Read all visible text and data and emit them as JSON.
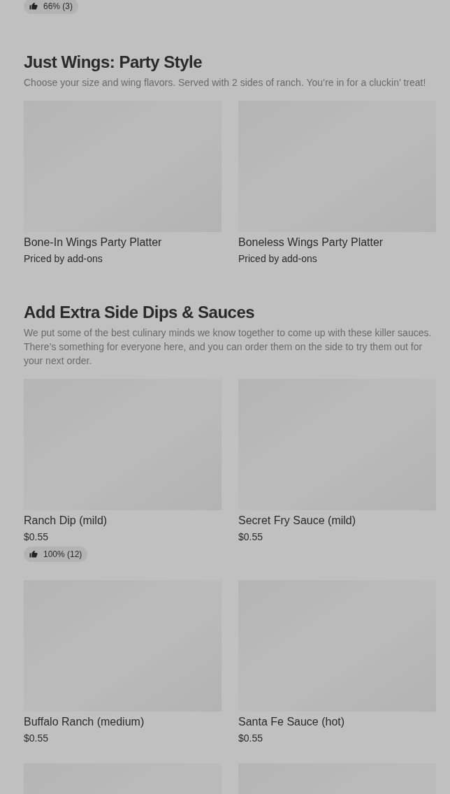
{
  "top_rating": {
    "text": "66% (3)"
  },
  "sections": [
    {
      "title": "Just Wings: Party Style",
      "description": "Choose your size and wing flavors. Served with 2 sides of ranch. You’re in for a cluckin’ treat!",
      "items": [
        {
          "kind": "product",
          "name": "Bone-In Wings Party Platter",
          "price": "Priced by add-ons"
        },
        {
          "kind": "product",
          "name": "Boneless Wings Party Platter",
          "price": "Priced by add-ons"
        }
      ]
    },
    {
      "title": "Add Extra Side Dips & Sauces",
      "description": "We put some of the best culinary minds we know together to come up with these killer sauces. There’s something for everyone here, and you can order them on the side to try them out for your next order.",
      "items": [
        {
          "kind": "product",
          "name": "Ranch Dip (mild)",
          "price": "$0.55",
          "rating": "100% (12)"
        },
        {
          "kind": "product",
          "name": "Secret Fry Sauce (mild)",
          "price": "$0.55"
        },
        {
          "kind": "product",
          "name": "Buffalo Ranch (medium)",
          "price": "$0.55"
        },
        {
          "kind": "product",
          "name": "Santa Fe Sauce (hot)",
          "price": "$0.55"
        },
        {
          "kind": "image_only"
        },
        {
          "kind": "image_only"
        }
      ]
    }
  ]
}
